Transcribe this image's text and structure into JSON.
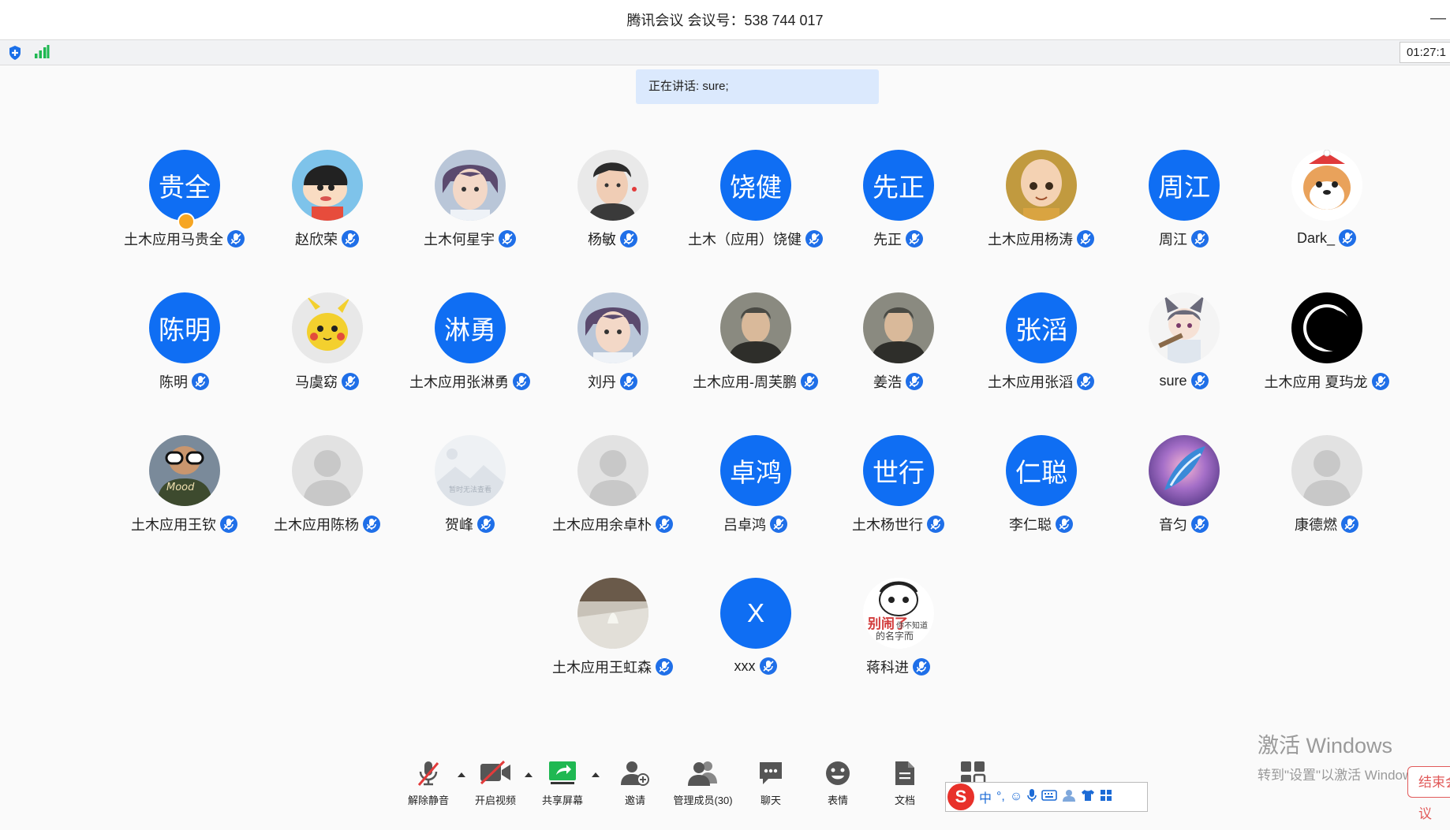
{
  "window": {
    "title": "腾讯会议 会议号：538 744 017",
    "minimize": "—",
    "timer": "01:27:1"
  },
  "speaking_banner": "正在讲话: sure;",
  "colors": {
    "accent": "#0f6ef3",
    "signal": "#1fb852",
    "end": "#e15a5a"
  },
  "participants": [
    {
      "name": "土木应用马贵全",
      "avatar_text": "贵全",
      "avatar_icon": null,
      "host": true
    },
    {
      "name": "赵欣荣",
      "avatar_text": null,
      "avatar_icon": "cartoon-boy-avatar"
    },
    {
      "name": "土木何星宇",
      "avatar_text": null,
      "avatar_icon": "anime-boy-avatar"
    },
    {
      "name": "杨敏",
      "avatar_text": null,
      "avatar_icon": "photo-boy-avatar"
    },
    {
      "name": "土木（应用）饶健",
      "avatar_text": "饶健",
      "avatar_icon": null
    },
    {
      "name": "先正",
      "avatar_text": "先正",
      "avatar_icon": null
    },
    {
      "name": "土木应用杨涛",
      "avatar_text": null,
      "avatar_icon": "cartoon-monk-avatar"
    },
    {
      "name": "周江",
      "avatar_text": "周江",
      "avatar_icon": null
    },
    {
      "name": "Dark_",
      "avatar_text": null,
      "avatar_icon": "cartoon-dog-avatar"
    },
    {
      "name": "陈明",
      "avatar_text": "陈明",
      "avatar_icon": null
    },
    {
      "name": "马虞窈",
      "avatar_text": null,
      "avatar_icon": "pikachu-avatar"
    },
    {
      "name": "土木应用张淋勇",
      "avatar_text": "淋勇",
      "avatar_icon": null
    },
    {
      "name": "刘丹",
      "avatar_text": null,
      "avatar_icon": "anime-boy-avatar"
    },
    {
      "name": "土木应用-周芙鹏",
      "avatar_text": null,
      "avatar_icon": "photo-man-avatar"
    },
    {
      "name": "姜浩",
      "avatar_text": null,
      "avatar_icon": "photo-man-avatar"
    },
    {
      "name": "土木应用张滔",
      "avatar_text": "张滔",
      "avatar_icon": null
    },
    {
      "name": "sure",
      "avatar_text": null,
      "avatar_icon": "anime-fox-avatar"
    },
    {
      "name": "土木应用  夏玙龙",
      "avatar_text": null,
      "avatar_icon": "eclipse-avatar"
    },
    {
      "name": "土木应用王钦",
      "avatar_text": null,
      "avatar_icon": "mood-kid-avatar",
      "avatar_caption": "Mood"
    },
    {
      "name": "土木应用陈杨",
      "avatar_text": null,
      "avatar_icon": "default-person-avatar"
    },
    {
      "name": "贺峰",
      "avatar_text": null,
      "avatar_icon": "image-unavailable-avatar",
      "avatar_caption": "暂时无法查看"
    },
    {
      "name": "土木应用余卓朴",
      "avatar_text": null,
      "avatar_icon": "default-person-avatar"
    },
    {
      "name": "吕卓鸿",
      "avatar_text": "卓鸿",
      "avatar_icon": null
    },
    {
      "name": "土木杨世行",
      "avatar_text": "世行",
      "avatar_icon": null
    },
    {
      "name": "李仁聪",
      "avatar_text": "仁聪",
      "avatar_icon": null
    },
    {
      "name": "音匀",
      "avatar_text": null,
      "avatar_icon": "fantasy-art-avatar"
    },
    {
      "name": "康德燃",
      "avatar_text": null,
      "avatar_icon": "default-person-avatar"
    },
    {
      "name": "土木应用王虹森",
      "avatar_text": null,
      "avatar_icon": "photo-scene-avatar"
    },
    {
      "name": "xxx",
      "avatar_text": "X",
      "avatar_icon": null
    },
    {
      "name": "蒋科进",
      "avatar_text": null,
      "avatar_icon": "meme-avatar",
      "avatar_caption": "别闹了",
      "avatar_caption2": "你不知道",
      "avatar_caption3": "的名字而"
    }
  ],
  "toolbar": {
    "unmute": "解除静音",
    "video": "开启视频",
    "share": "共享屏幕",
    "invite": "邀请",
    "members": "管理成员(30)",
    "chat": "聊天",
    "reactions": "表情",
    "docs": "文档",
    "apps_icon": "apps-grid-icon"
  },
  "ime": {
    "logo": "S",
    "mode": "中",
    "punct": "°,",
    "icons": [
      "emoji-icon",
      "mic-icon",
      "keyboard-icon",
      "user-icon",
      "shirt-icon",
      "grid-icon"
    ]
  },
  "watermark": {
    "line1": "激活 Windows",
    "line2": "转到\"设置\"以激活 Windows。"
  },
  "end_button": "结束会议"
}
